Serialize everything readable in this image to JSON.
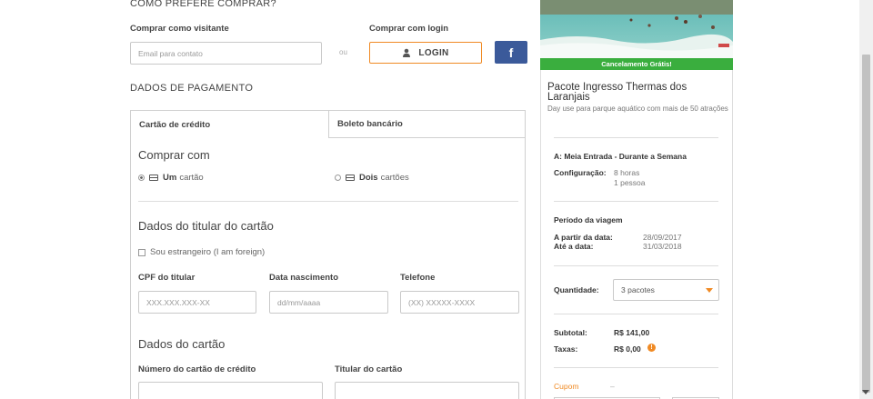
{
  "purchase": {
    "title": "COMO PREFERE COMPRAR?",
    "guest_label": "Comprar como visitante",
    "login_label": "Comprar com login",
    "email_placeholder": "Email para contato",
    "or_text": "ou",
    "login_button": "LOGIN",
    "facebook_button": "f"
  },
  "payment": {
    "title": "DADOS DE PAGAMENTO",
    "tabs": [
      {
        "label": "Cartão de crédito",
        "active": true
      },
      {
        "label": "Boleto bancário",
        "active": false
      }
    ],
    "buy_with_title": "Comprar com",
    "options": [
      {
        "strong": "Um",
        "text": "cartão",
        "selected": true
      },
      {
        "strong": "Dois",
        "text": "cartões",
        "selected": false
      }
    ],
    "holder_title": "Dados do titular do cartão",
    "foreigner_label": "Sou estrangeiro (I am foreign)",
    "fields": [
      {
        "label": "CPF do titular",
        "placeholder": "XXX.XXX.XXX-XX"
      },
      {
        "label": "Data nascimento",
        "placeholder": "dd/mm/aaaa"
      },
      {
        "label": "Telefone",
        "placeholder": "(XX) XXXXX-XXXX"
      }
    ],
    "card_title": "Dados do cartão",
    "card_fields": [
      {
        "label": "Número do cartão de crédito"
      },
      {
        "label": "Titular do cartão"
      }
    ]
  },
  "summary": {
    "banner": "Cancelamento Grátis!",
    "product_title": "Pacote Ingresso Thermas dos Laranjais",
    "product_desc": "Day use para parque aquático com mais de 50 atrações",
    "option_name": "A: Meia Entrada - Durante a Semana",
    "config_label": "Configuração:",
    "config_values": [
      "8 horas",
      "1 pessoa"
    ],
    "period_title": "Período da viagem",
    "from_label": "A partir da data:",
    "from_value": "28/09/2017",
    "until_label": "Até a data:",
    "until_value": "31/03/2018",
    "quantity_label": "Quantidade:",
    "quantity_value": "3 pacotes",
    "subtotal_label": "Subtotal:",
    "subtotal_value": "R$ 141,00",
    "taxes_label": "Taxas:",
    "taxes_value": "R$ 0,00",
    "coupon_label": "Cupom",
    "coupon_dash": "–"
  },
  "colors": {
    "accent": "#f08a24",
    "facebook": "#3b5a9a",
    "banner_green": "#3aae3e",
    "info": "#f08a24"
  }
}
